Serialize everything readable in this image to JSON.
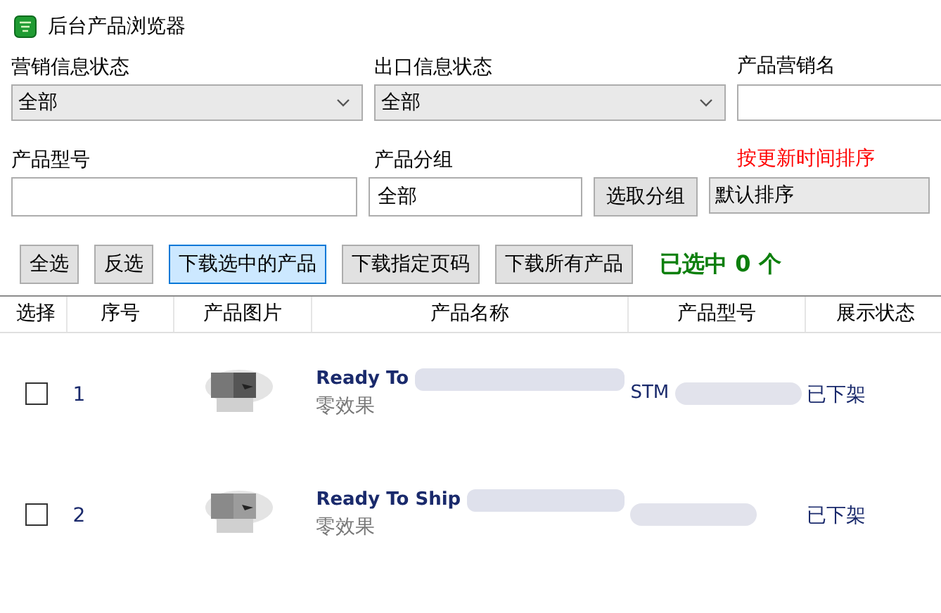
{
  "window": {
    "title": "后台产品浏览器"
  },
  "filters": {
    "marketing_status": {
      "label": "营销信息状态",
      "value": "全部"
    },
    "export_status": {
      "label": "出口信息状态",
      "value": "全部"
    },
    "marketing_name": {
      "label": "产品营销名"
    },
    "model": {
      "label": "产品型号"
    },
    "group": {
      "label": "产品分组",
      "value": "全部",
      "button": "选取分组"
    },
    "sort": {
      "label": "按更新时间排序",
      "value": "默认排序"
    }
  },
  "buttons": [
    {
      "label": "全选",
      "selected": false
    },
    {
      "label": "反选",
      "selected": false
    },
    {
      "label": "下载选中的产品",
      "selected": true
    },
    {
      "label": "下载指定页码",
      "selected": false
    },
    {
      "label": "下载所有产品",
      "selected": false
    }
  ],
  "selection_count": "已选中 0 个",
  "table": {
    "columns": [
      "选择",
      "序号",
      "产品图片",
      "产品名称",
      "产品型号",
      "展示状态"
    ],
    "rows": [
      {
        "checked": false,
        "index": "1",
        "name": "Ready To",
        "effect": "零效果",
        "model": "STM",
        "status": "已下架"
      },
      {
        "checked": false,
        "index": "2",
        "name": "Ready To Ship",
        "effect": "零效果",
        "status": "已下架"
      }
    ]
  }
}
